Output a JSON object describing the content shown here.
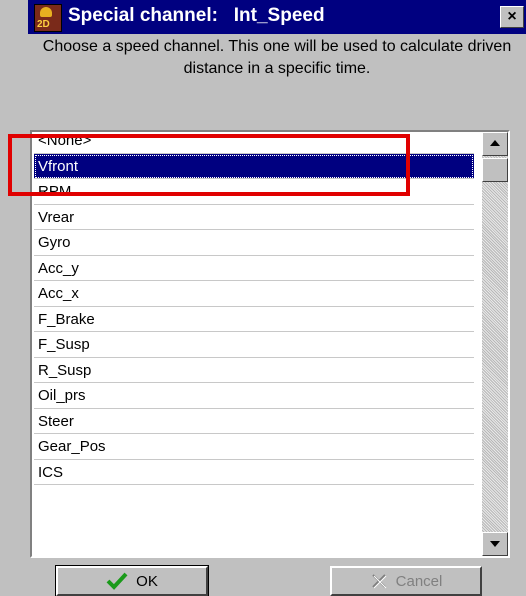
{
  "window": {
    "title": "Special channel:   Int_Speed",
    "app_icon_text": "2D",
    "close_label": "×"
  },
  "description": "Choose a speed channel. This one will be used to calculate driven distance in a specific time.",
  "listbox": {
    "selected": "Vfront",
    "items": [
      "<None>",
      "Vfront",
      "RPM",
      "Vrear",
      "Gyro",
      "Acc_y",
      "Acc_x",
      "F_Brake",
      "F_Susp",
      "R_Susp",
      "Oil_prs",
      "Steer",
      "Gear_Pos",
      "ICS"
    ]
  },
  "buttons": {
    "ok_label": "OK",
    "cancel_label": "Cancel"
  },
  "colors": {
    "title_bar": "#000080",
    "selection": "#000080",
    "highlight_box": "#e00000",
    "ok_check": "#1a9a1a"
  }
}
